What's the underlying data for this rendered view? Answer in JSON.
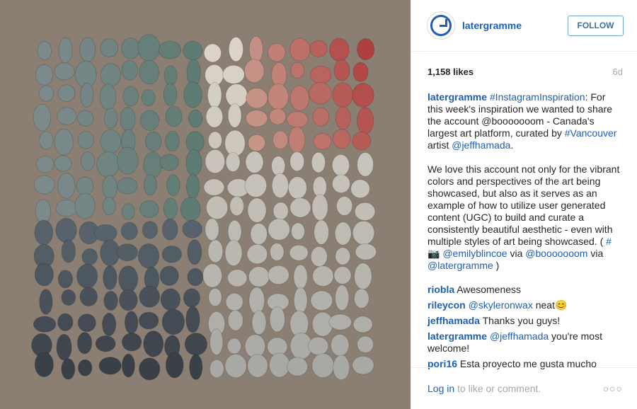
{
  "photo": {
    "alt": "Beach stones arranged in a color gradient square on sand",
    "sand_color": "#8a7f72",
    "stone_palette": [
      "#6c7378",
      "#7d8a8c",
      "#9aa0a2",
      "#5a6670",
      "#c8c2b5",
      "#d9a080",
      "#b85a4e",
      "#8a4040",
      "#e0d8cc",
      "#5c7a72",
      "#3e4650",
      "#8f9aa0"
    ]
  },
  "header": {
    "avatar_icon": "later-clock-icon",
    "username": "latergramme",
    "follow_label": "FOLLOW"
  },
  "meta": {
    "likes": "1,158 likes",
    "time": "6d"
  },
  "caption": {
    "user": "latergramme",
    "p1_tag1": "#InstagramInspiration",
    "p1_text1": ": For this week's inspiration we wanted to share the account @booooooom - Canada's largest art platform, curated by ",
    "p1_tag2": "#Vancouver",
    "p1_text2": " artist ",
    "p1_mention": "@jeffhamada",
    "p1_text3": ".",
    "p2_text1": "We love this account not only for the vibrant colors and perspectives of the art being showcased, but also as it serves as an example of how to utilize user generated content (UGC) to build and curate a consistently beautiful aesthetic - even with multiple styles of art being showcased. ( ",
    "p2_tag": "#📷",
    "p2_mention1": "@emilyblincoe",
    "p2_text2": " via ",
    "p2_mention2": "@booooooom",
    "p2_text3": " via ",
    "p2_mention3": "@latergramme",
    "p2_text4": " )"
  },
  "comments": [
    {
      "user": "riobla",
      "text": "Awesomeness"
    },
    {
      "user": "rileycon",
      "mention": "@skyleronwax",
      "text": " neat😊"
    },
    {
      "user": "jeffhamada",
      "text": "Thanks you guys!"
    },
    {
      "user": "latergramme",
      "mention": "@jeffhamada",
      "text": " you're most welcome!"
    },
    {
      "user": "pori16",
      "text": "Esta proyecto me gusta mucho"
    }
  ],
  "footer": {
    "login": "Log in",
    "login_suffix": " to like or comment.",
    "more": "○○○"
  }
}
